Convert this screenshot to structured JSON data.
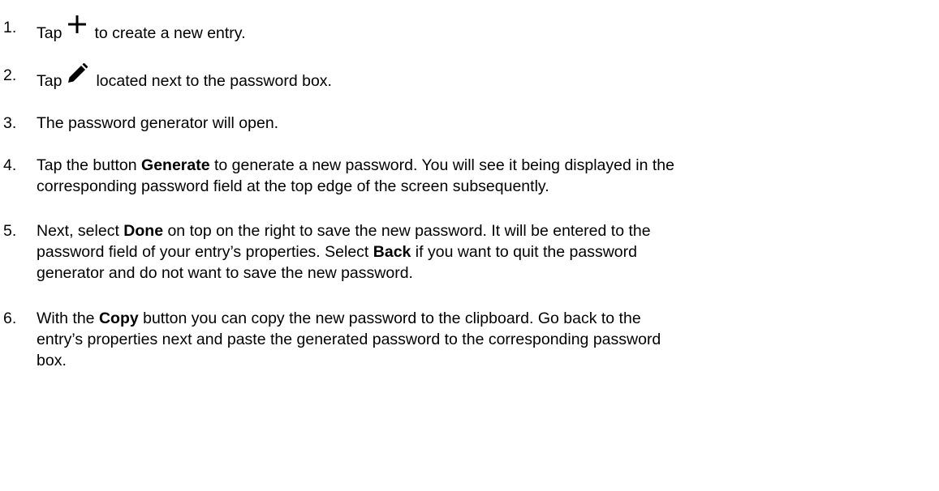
{
  "steps": [
    {
      "number": "1.",
      "before_icon": "Tap",
      "icon": "plus-icon",
      "after_icon": "to create a new entry."
    },
    {
      "number": "2.",
      "before_icon": "Tap",
      "icon": "pencil-icon",
      "after_icon": "located next to the password box."
    },
    {
      "number": "3.",
      "text": "The password generator will open."
    },
    {
      "number": "4.",
      "line1_a": "Tap the button ",
      "line1_bold": "Generate",
      "line1_b": " to generate a new password. You will see it being displayed in the",
      "line2": "corresponding password field at the top edge of the screen subsequently."
    },
    {
      "number": "5.",
      "line1_a": "Next, select ",
      "line1_bold": "Done",
      "line1_b": " on top on the right to save the new password. It will be entered to the",
      "line2_a": "password field of your entry’s properties. Select ",
      "line2_bold": "Back",
      "line2_b": " if you want to quit the password",
      "line3": "generator and do not want to save the new password."
    },
    {
      "number": "6.",
      "line1_a": "With the ",
      "line1_bold": "Copy",
      "line1_b": " button you can copy the new password to the clipboard. Go back to the",
      "line2": "entry’s properties next and paste the generated password to the corresponding password",
      "line3": "box."
    }
  ],
  "colors": {
    "text": "#000000",
    "background": "#ffffff"
  }
}
